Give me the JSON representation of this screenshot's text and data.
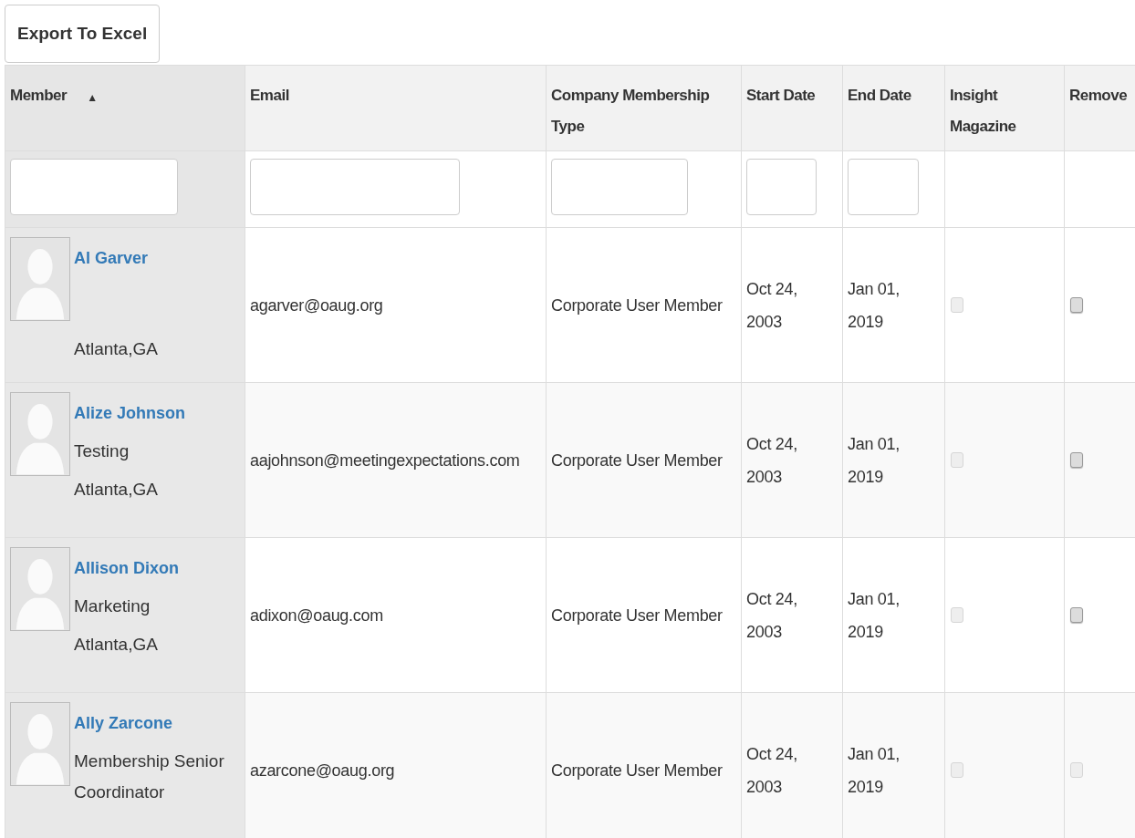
{
  "export_button": "Export To Excel",
  "table": {
    "columns": [
      {
        "label": "Member",
        "sort_indicator": "▲"
      },
      {
        "label": "Email"
      },
      {
        "label": "Company Membership Type"
      },
      {
        "label": "Start Date"
      },
      {
        "label": "End Date"
      },
      {
        "label": "Insight Magazine"
      },
      {
        "label": "Remove"
      }
    ],
    "filters": [
      {
        "kind": "field"
      },
      {
        "kind": "field"
      },
      {
        "kind": "field"
      },
      {
        "kind": "field"
      },
      {
        "kind": "field"
      },
      {
        "kind": "none"
      },
      {
        "kind": "none"
      }
    ],
    "rows": [
      {
        "name": "Al Garver",
        "location": "Atlanta,GA",
        "email": "agarver@oaug.org",
        "membership_type": "Corporate User Member",
        "start_date": "Oct 24, 2003",
        "end_date": "Jan 01, 2019",
        "insight_magazine": {
          "checked": false,
          "disabled": true
        },
        "remove": {
          "checked": false,
          "disabled": false
        }
      },
      {
        "name": "Alize Johnson",
        "title": "Testing",
        "location": "Atlanta,GA",
        "email": "aajohnson@meetingexpectations.com",
        "membership_type": "Corporate User Member",
        "start_date": "Oct 24, 2003",
        "end_date": "Jan 01, 2019",
        "insight_magazine": {
          "checked": false,
          "disabled": true
        },
        "remove": {
          "checked": false,
          "disabled": false
        }
      },
      {
        "name": "Allison Dixon",
        "title": "Marketing",
        "location": "Atlanta,GA",
        "email": "adixon@oaug.com",
        "membership_type": "Corporate User Member",
        "start_date": "Oct 24, 2003",
        "end_date": "Jan 01, 2019",
        "insight_magazine": {
          "checked": false,
          "disabled": true
        },
        "remove": {
          "checked": false,
          "disabled": false
        }
      },
      {
        "name": "Ally Zarcone",
        "title": "Membership Senior Coordinator",
        "email": "azarcone@oaug.org",
        "membership_type": "Corporate User Member",
        "start_date": "Oct 24, 2003",
        "end_date": "Jan 01, 2019",
        "insight_magazine": {
          "checked": false,
          "disabled": true
        },
        "remove": {
          "checked": false,
          "disabled": true
        }
      }
    ]
  }
}
